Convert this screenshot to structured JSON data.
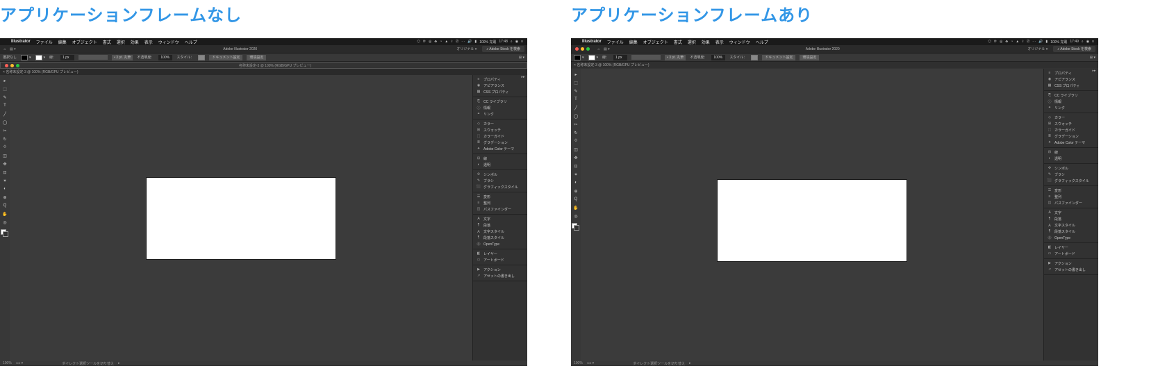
{
  "captions": {
    "without_frame": "アプリケーションフレームなし",
    "with_frame": "アプリケーションフレームあり"
  },
  "menubar": {
    "app": "Illustrator",
    "items": [
      "ファイル",
      "編集",
      "オブジェクト",
      "書式",
      "選択",
      "効果",
      "表示",
      "ウィンドウ",
      "ヘルプ"
    ],
    "status_battery": "100% 充電",
    "clock_left": "17:48",
    "clock_right": "17:49"
  },
  "appheader": {
    "title": "Adobe Illustrator 2020",
    "original": "オリジナル ▾",
    "stock": "Adobe Stock を検索"
  },
  "controlbar": {
    "selection_none": "選択なし",
    "stroke_label": "線：",
    "stroke_value": "1 px",
    "corner_preset": "3 pt. 丸筆",
    "opacity_label": "不透明度：",
    "opacity_value": "100%",
    "style_label": "スタイル：",
    "docset": "ドキュメント設定",
    "envset": "環境設定"
  },
  "document": {
    "tab_left": "名称未設定-3 @ 100% (RGB/GPU プレビュー)",
    "tab_right": "名称未設定-3 @ 100% (RGB/GPU プレビュー)"
  },
  "panels": {
    "groups": [
      {
        "items": [
          {
            "icon": "≡",
            "label": "プロパティ"
          },
          {
            "icon": "◉",
            "label": "アピアランス"
          },
          {
            "icon": "▦",
            "label": "CSS プロパティ"
          }
        ]
      },
      {
        "items": [
          {
            "icon": "⎘",
            "label": "CC ライブラリ"
          },
          {
            "icon": "ⓘ",
            "label": "情報"
          },
          {
            "icon": "⚭",
            "label": "リンク"
          }
        ]
      },
      {
        "items": [
          {
            "icon": "◇",
            "label": "カラー"
          },
          {
            "icon": "⊞",
            "label": "スウォッチ"
          },
          {
            "icon": "⬚",
            "label": "カラーガイド"
          },
          {
            "icon": "≣",
            "label": "グラデーション"
          },
          {
            "icon": "✦",
            "label": "Adobe Color テーマ"
          }
        ]
      },
      {
        "items": [
          {
            "icon": "⊟",
            "label": "線"
          },
          {
            "icon": "◐",
            "label": "透明"
          }
        ]
      },
      {
        "items": [
          {
            "icon": "✣",
            "label": "シンボル"
          },
          {
            "icon": "✎",
            "label": "ブラシ"
          },
          {
            "icon": "⬛",
            "label": "グラフィックスタイル"
          }
        ]
      },
      {
        "items": [
          {
            "icon": "☰",
            "label": "変形"
          },
          {
            "icon": "≡",
            "label": "整列"
          },
          {
            "icon": "◫",
            "label": "パスファインダー"
          }
        ]
      },
      {
        "items": [
          {
            "icon": "A",
            "label": "文字"
          },
          {
            "icon": "¶",
            "label": "段落"
          },
          {
            "icon": "Ａ",
            "label": "文字スタイル"
          },
          {
            "icon": "¶",
            "label": "段落スタイル"
          },
          {
            "icon": "Ⓞ",
            "label": "OpenType"
          }
        ]
      },
      {
        "items": [
          {
            "icon": "◧",
            "label": "レイヤー"
          },
          {
            "icon": "▭",
            "label": "アートボード"
          }
        ]
      },
      {
        "items": [
          {
            "icon": "▶",
            "label": "アクション"
          },
          {
            "icon": "↗",
            "label": "アセットの書き出し"
          }
        ]
      }
    ]
  },
  "tools": [
    "▸",
    "⬚",
    "✎",
    "T",
    "╱",
    "◯",
    "✂",
    "↻",
    "⟐",
    "◫",
    "✥",
    "⊡",
    "✶",
    "◐",
    "⊕",
    "Q",
    "✋",
    "◎"
  ],
  "statusbar": {
    "zoom": "100%",
    "tool_hint": "ダイレクト選択ツールを切り替え"
  }
}
